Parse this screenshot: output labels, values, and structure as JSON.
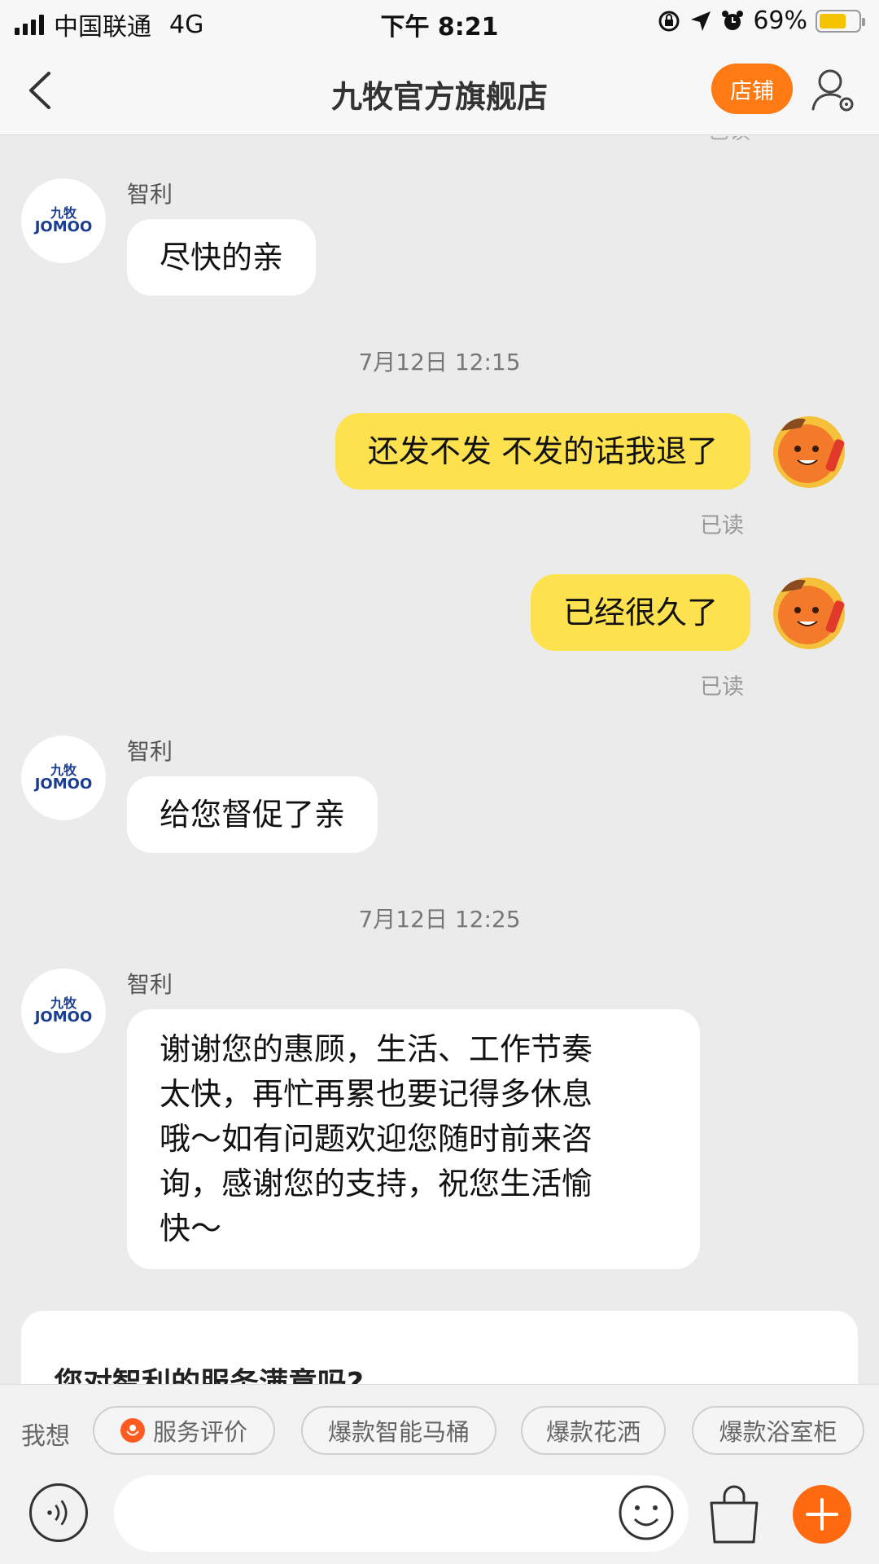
{
  "status_bar": {
    "carrier": "中国联通",
    "network": "4G",
    "time": "下午 8:21",
    "battery": "69%",
    "battery_level": 0.69
  },
  "nav": {
    "title": "九牧官方旗舰店",
    "shop_button": "店铺"
  },
  "chat": {
    "faded_top": "已读",
    "messages": [
      {
        "sender": "智利",
        "text": "尽快的亲"
      },
      {
        "timestamp": "7月12日 12:15"
      },
      {
        "text": "还发不发 不发的话我退了",
        "status": "已读"
      },
      {
        "text": "已经很久了",
        "status": "已读"
      },
      {
        "sender": "智利",
        "text": "给您督促了亲"
      },
      {
        "timestamp": "7月12日 12:25"
      },
      {
        "sender": "智利",
        "lines": [
          "谢谢您的惠顾，生活、工作节奏",
          "太快，再忙再累也要记得多休息",
          "哦～如有问题欢迎您随时前来咨",
          "询，感谢您的支持，祝您生活愉",
          "快～"
        ]
      }
    ],
    "avatar_logo_cn": "九牧",
    "avatar_logo_en": "JOMOO",
    "survey_title": "您对智利的服务满意吗?"
  },
  "quick_bar": {
    "label": "我想",
    "chips": [
      "服务评价",
      "爆款智能马桶",
      "爆款花洒",
      "爆款浴室柜"
    ]
  },
  "input": {
    "placeholder": ""
  },
  "colors": {
    "accent": "#ff7a12",
    "outgoing_bubble": "#fde14f",
    "background": "#ebebeb"
  }
}
